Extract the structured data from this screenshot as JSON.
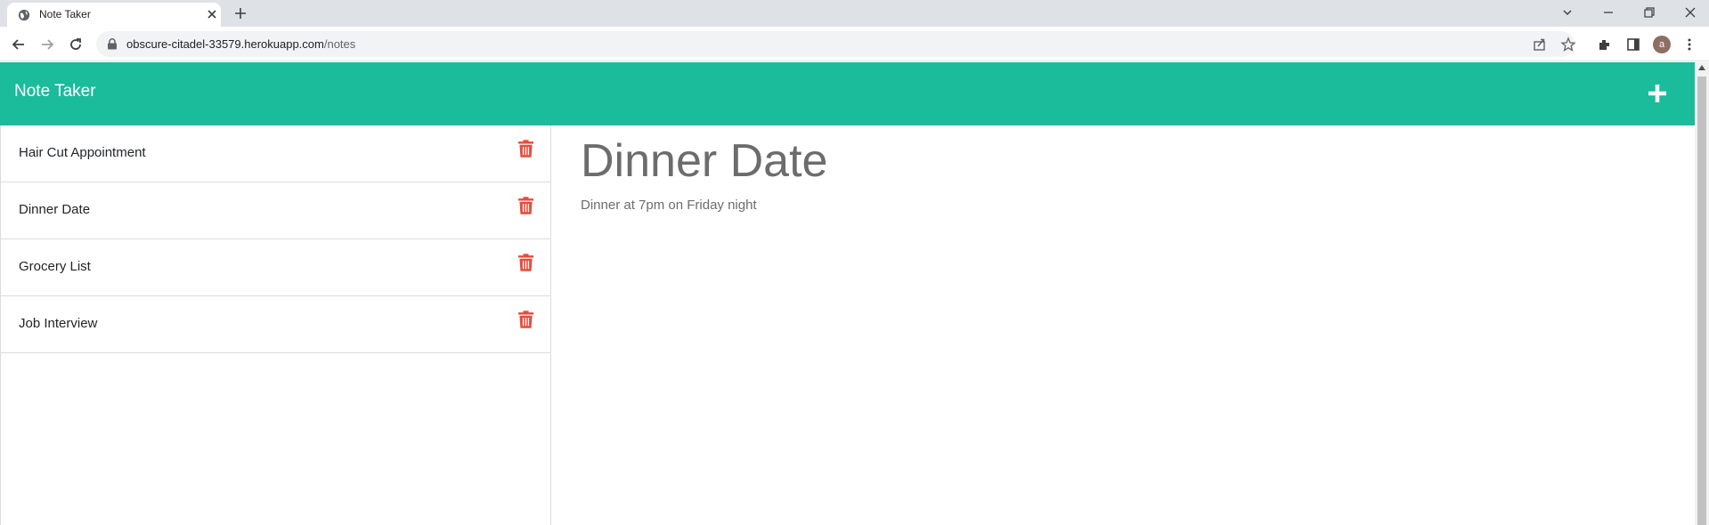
{
  "browser": {
    "tab_title": "Note Taker",
    "url_host": "obscure-citadel-33579.herokuapp.com",
    "url_path": "/notes",
    "profile_initial": "a"
  },
  "app": {
    "brand": "Note Taker",
    "accent_color": "#1abc9c",
    "delete_color": "#e74c3c"
  },
  "notes": [
    {
      "title": "Hair Cut Appointment"
    },
    {
      "title": "Dinner Date"
    },
    {
      "title": "Grocery List"
    },
    {
      "title": "Job Interview"
    }
  ],
  "active_note": {
    "title": "Dinner Date",
    "text": "Dinner at 7pm on Friday night"
  },
  "icons": {
    "add": "plus-icon",
    "delete": "trash-icon",
    "favicon": "globe-icon"
  }
}
